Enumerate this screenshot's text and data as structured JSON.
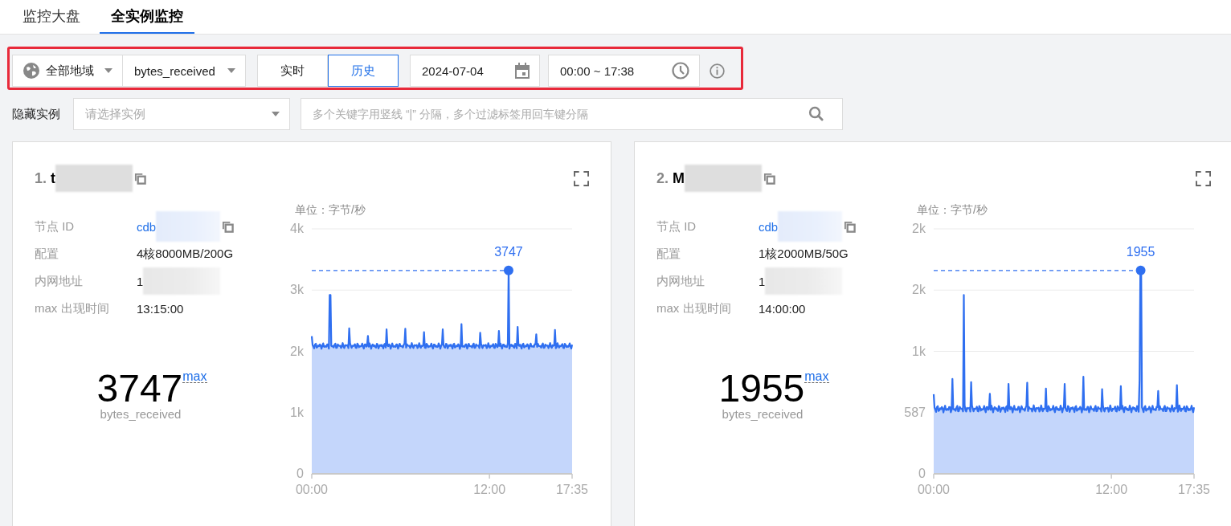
{
  "tabs": [
    {
      "label": "监控大盘",
      "selected": false
    },
    {
      "label": "全实例监控",
      "selected": true
    }
  ],
  "toolbar": {
    "region": {
      "label": "全部地域"
    },
    "metric": {
      "value": "bytes_received"
    },
    "modes": [
      {
        "label": "实时",
        "selected": false
      },
      {
        "label": "历史",
        "selected": true
      }
    ],
    "date": {
      "value": "2024-07-04"
    },
    "time_range": {
      "value": "00:00 ~ 17:38"
    }
  },
  "filters": {
    "hide_label": "隐藏实例",
    "instance_select": {
      "placeholder": "请选择实例"
    },
    "search": {
      "placeholder": "多个关键字用竖线 “|” 分隔，多个过滤标签用回车键分隔"
    }
  },
  "cards": [
    {
      "rank": "1.",
      "name": "t",
      "name_redacted": true,
      "fields": [
        {
          "label": "节点 ID",
          "value": "cdb",
          "kind": "link",
          "redacted": true
        },
        {
          "label": "配置",
          "value": "4核8000MB/200G",
          "kind": "text",
          "redacted": false
        },
        {
          "label": "内网地址",
          "value": "1",
          "kind": "text",
          "redacted": true
        },
        {
          "label": "max 出现时间",
          "value": "13:15:00",
          "kind": "text",
          "redacted": false
        }
      ],
      "max_value": "3747",
      "max_link": "max",
      "metric": "bytes_received",
      "chart": {
        "unit": "单位：字节/秒",
        "yticks": [
          "4k",
          "3k",
          "2k",
          "1k",
          "0"
        ],
        "xticks": [
          "00:00",
          "12:00",
          "17:35"
        ],
        "peak_label": "3747"
      }
    },
    {
      "rank": "2.",
      "name": "M",
      "name_redacted": true,
      "fields": [
        {
          "label": "节点 ID",
          "value": "cdb",
          "kind": "link",
          "redacted": true
        },
        {
          "label": "配置",
          "value": "1核2000MB/50G",
          "kind": "text",
          "redacted": false
        },
        {
          "label": "内网地址",
          "value": "1",
          "kind": "text",
          "redacted": true
        },
        {
          "label": "max 出现时间",
          "value": "14:00:00",
          "kind": "text",
          "redacted": false
        }
      ],
      "max_value": "1955",
      "max_link": "max",
      "metric": "bytes_received",
      "chart": {
        "unit": "单位：字节/秒",
        "yticks": [
          "2k",
          "2k",
          "1k",
          "587",
          "0"
        ],
        "xticks": [
          "00:00",
          "12:00",
          "17:35"
        ],
        "peak_label": "1955"
      }
    }
  ]
}
